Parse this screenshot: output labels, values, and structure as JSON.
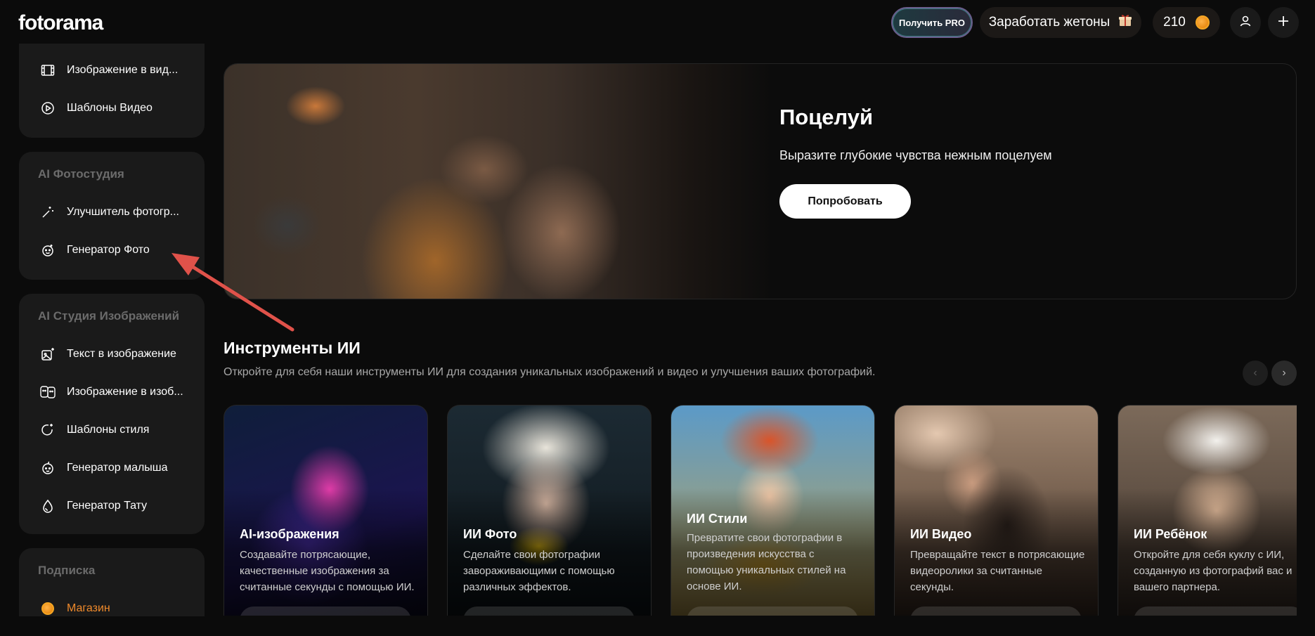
{
  "header": {
    "logo": "fotorama",
    "pro_label": "Получить PRO",
    "earn_label": "Заработать жетоны",
    "coins_value": "210"
  },
  "sidebar": {
    "video_items": [
      {
        "label": "Изображение в вид...",
        "icon": "film-icon"
      },
      {
        "label": "Шаблоны Видео",
        "icon": "play-circle-icon"
      }
    ],
    "photo_studio": {
      "title": "AI Фотостудия",
      "items": [
        {
          "label": "Улучшитель фотогр...",
          "icon": "magic-wand-icon"
        },
        {
          "label": "Генератор Фото",
          "icon": "face-icon"
        }
      ]
    },
    "image_studio": {
      "title": "AI Студия Изображений",
      "items": [
        {
          "label": "Текст в изображение",
          "icon": "image-sparkle-icon"
        },
        {
          "label": "Изображение в изоб...",
          "icon": "faces-icon"
        },
        {
          "label": "Шаблоны стиля",
          "icon": "style-icon"
        },
        {
          "label": "Генератор малыша",
          "icon": "baby-icon"
        },
        {
          "label": "Генератор Тату",
          "icon": "drop-icon"
        }
      ]
    },
    "subscription": {
      "title": "Подписка",
      "shop_label": "Магазин"
    }
  },
  "hero": {
    "title": "Поцелуй",
    "subtitle": "Выразите глубокие чувства нежным поцелуем",
    "button": "Попробовать"
  },
  "tools_section": {
    "title": "Инструменты ИИ",
    "subtitle": "Откройте для себя наши инструменты ИИ для создания уникальных изображений и видео и улучшения ваших фотографий.",
    "cards": [
      {
        "title": "AI-изображения",
        "desc": "Создавайте потрясающие, качественные изображения за считанные секунды с помощью ИИ."
      },
      {
        "title": "ИИ Фото",
        "desc": "Сделайте свои фотографии завораживающими с помощью различных эффектов."
      },
      {
        "title": "ИИ Стили",
        "desc": "Превратите свои фотографии в произведения искусства с помощью уникальных стилей на основе ИИ."
      },
      {
        "title": "ИИ Видео",
        "desc": "Превращайте текст в потрясающие видеоролики за считанные секунды."
      },
      {
        "title": "ИИ Ребёнок",
        "desc": "Откройте для себя куклу с ИИ, созданную из фотографий вас и вашего партнера."
      }
    ]
  },
  "colors": {
    "background": "#0b0b0b",
    "card": "#1a1a1a",
    "accent_orange": "#f08a2b",
    "annotation_arrow": "#e0524a"
  }
}
